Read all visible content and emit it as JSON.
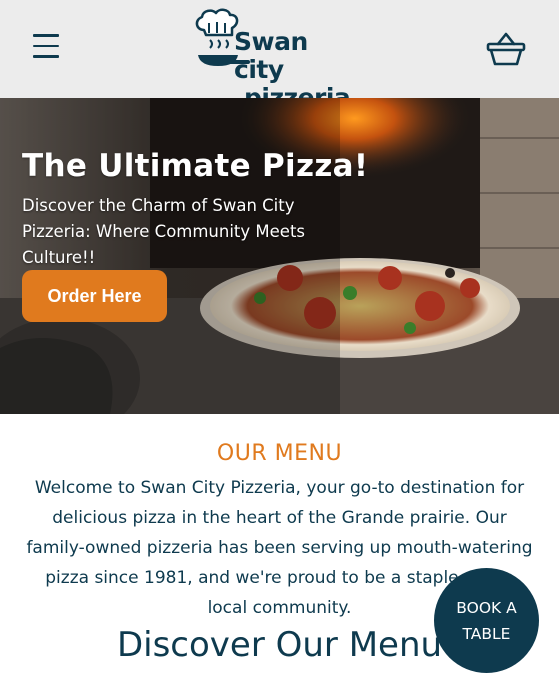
{
  "header": {
    "menu_icon": "hamburger-menu-icon",
    "logo": {
      "line1": "Swan city",
      "line2": "pizzeria"
    },
    "cart_icon": "shopping-basket-icon"
  },
  "hero": {
    "title": "The Ultimate Pizza!",
    "subtitle": "Discover the Charm of Swan City Pizzeria: Where Community Meets Culture!!",
    "order_button": "Order Here"
  },
  "menu_section": {
    "heading": "OUR MENU",
    "text": "Welcome to Swan City Pizzeria, your go-to destination for delicious pizza in the heart of the Grande prairie. Our family-owned pizzeria has been serving up mouth-watering pizza since 1981, and we're proud to be a staple of the local community.",
    "discover_heading": "Discover Our Menu"
  },
  "book_table": {
    "line1": "BOOK A",
    "line2": "TABLE"
  },
  "colors": {
    "navy": "#0e3a4e",
    "orange": "#e07a1e",
    "header_bg": "#ececec"
  }
}
